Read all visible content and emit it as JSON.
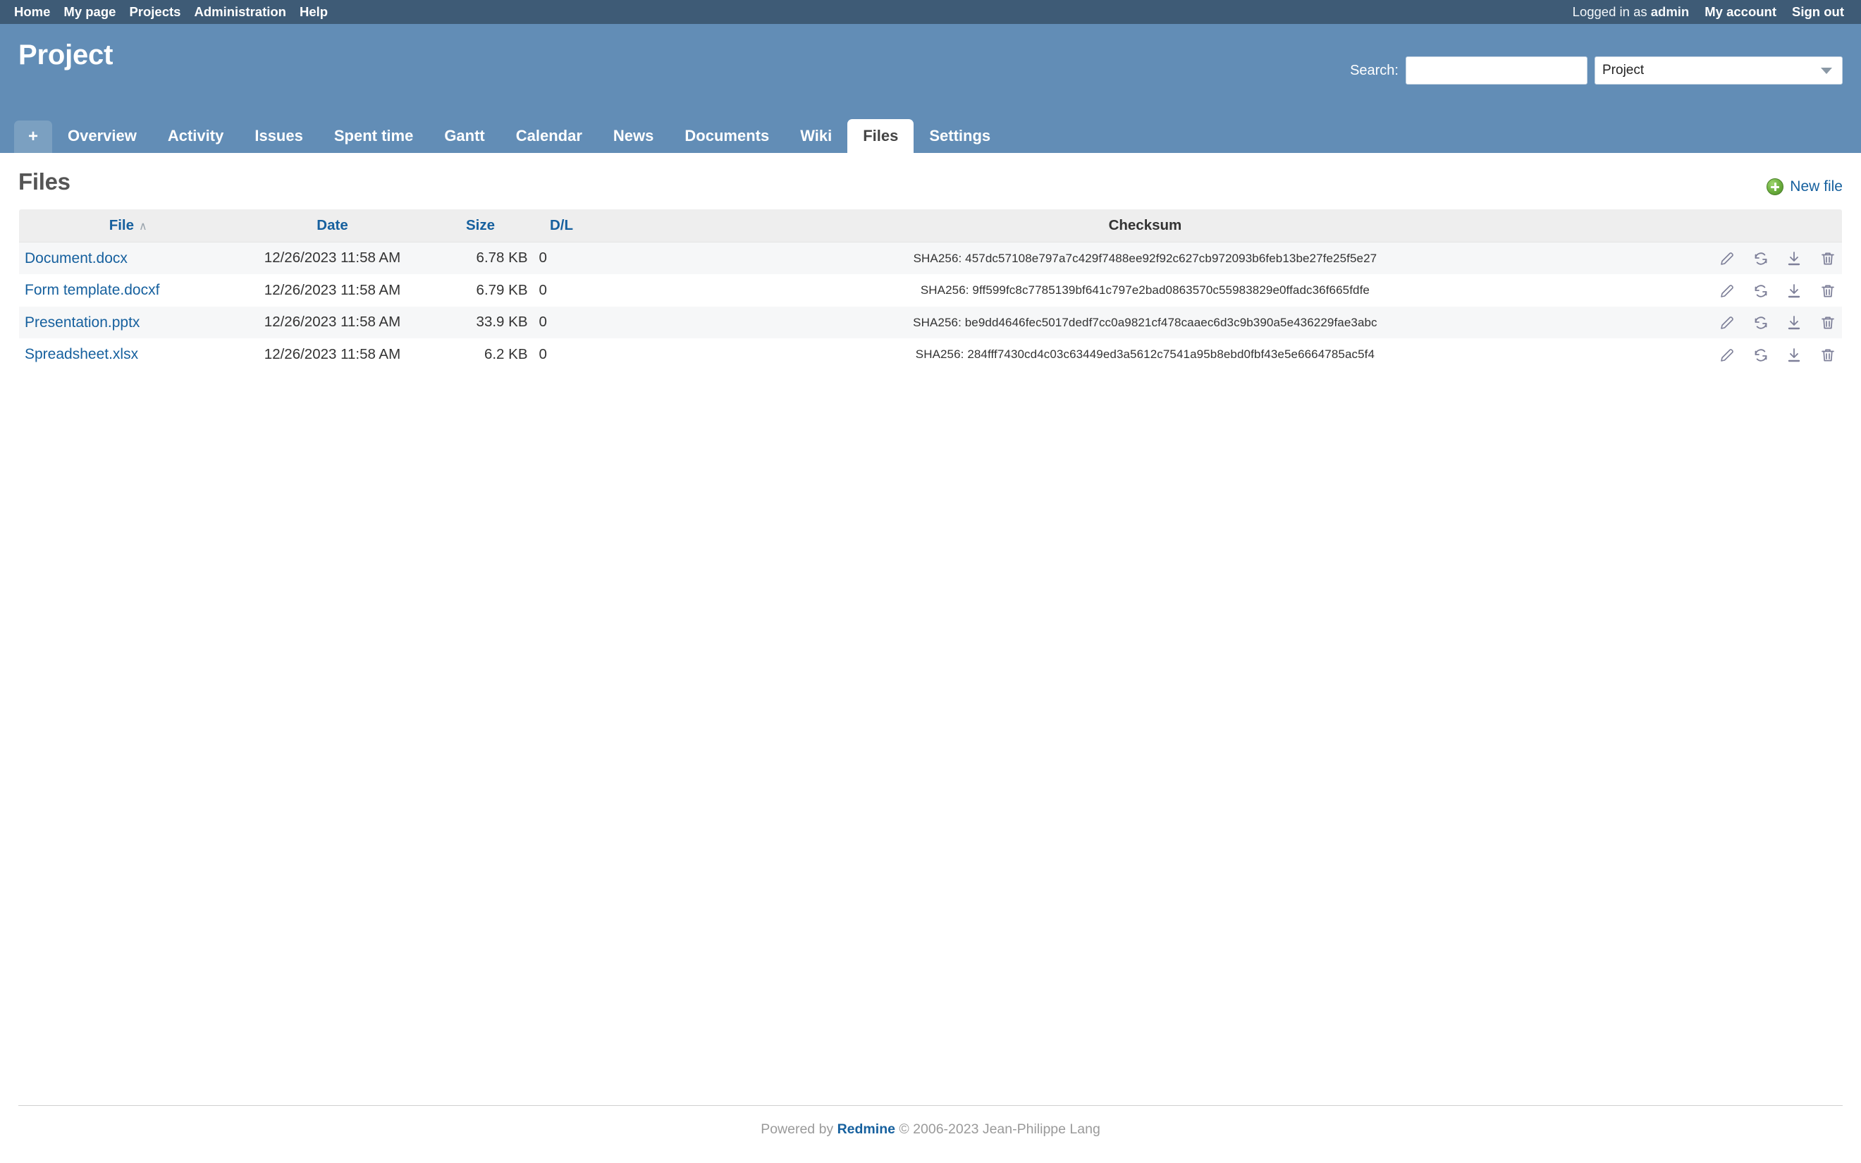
{
  "top_menu": {
    "left_items": [
      {
        "label": "Home",
        "name": "top-menu-home"
      },
      {
        "label": "My page",
        "name": "top-menu-my-page"
      },
      {
        "label": "Projects",
        "name": "top-menu-projects"
      },
      {
        "label": "Administration",
        "name": "top-menu-administration"
      },
      {
        "label": "Help",
        "name": "top-menu-help"
      }
    ],
    "logged_in_prefix": "Logged in as",
    "username": "admin",
    "my_account_label": "My account",
    "sign_out_label": "Sign out"
  },
  "header": {
    "project_title": "Project",
    "search_label": "Search:",
    "search_value": "",
    "search_placeholder": "",
    "search_scope_selected": "Project"
  },
  "main_menu": {
    "new_object_label": "+",
    "tabs": [
      {
        "label": "Overview",
        "name": "tab-overview",
        "selected": false
      },
      {
        "label": "Activity",
        "name": "tab-activity",
        "selected": false
      },
      {
        "label": "Issues",
        "name": "tab-issues",
        "selected": false
      },
      {
        "label": "Spent time",
        "name": "tab-spent-time",
        "selected": false
      },
      {
        "label": "Gantt",
        "name": "tab-gantt",
        "selected": false
      },
      {
        "label": "Calendar",
        "name": "tab-calendar",
        "selected": false
      },
      {
        "label": "News",
        "name": "tab-news",
        "selected": false
      },
      {
        "label": "Documents",
        "name": "tab-documents",
        "selected": false
      },
      {
        "label": "Wiki",
        "name": "tab-wiki",
        "selected": false
      },
      {
        "label": "Files",
        "name": "tab-files",
        "selected": true
      },
      {
        "label": "Settings",
        "name": "tab-settings",
        "selected": false
      }
    ]
  },
  "content": {
    "page_title": "Files",
    "new_file_label": "New file",
    "sort_indicator": "∧",
    "columns": {
      "file": "File",
      "date": "Date",
      "size": "Size",
      "dl": "D/L",
      "checksum": "Checksum"
    },
    "rows": [
      {
        "filename": "Document.docx",
        "date": "12/26/2023 11:58 AM",
        "size": "6.78 KB",
        "downloads": "0",
        "checksum": "SHA256: 457dc57108e797a7c429f7488ee92f92c627cb972093b6feb13be27fe25f5e27"
      },
      {
        "filename": "Form template.docxf",
        "date": "12/26/2023 11:58 AM",
        "size": "6.79 KB",
        "downloads": "0",
        "checksum": "SHA256: 9ff599fc8c7785139bf641c797e2bad0863570c55983829e0ffadc36f665fdfe"
      },
      {
        "filename": "Presentation.pptx",
        "date": "12/26/2023 11:58 AM",
        "size": "33.9 KB",
        "downloads": "0",
        "checksum": "SHA256: be9dd4646fec5017dedf7cc0a9821cf478caaec6d3c9b390a5e436229fae3abc"
      },
      {
        "filename": "Spreadsheet.xlsx",
        "date": "12/26/2023 11:58 AM",
        "size": "6.2 KB",
        "downloads": "0",
        "checksum": "SHA256: 284fff7430cd4c03c63449ed3a5612c7541a95b8ebd0fbf43e5e6664785ac5f4"
      }
    ],
    "row_actions": [
      {
        "name": "edit-icon",
        "title": "Edit"
      },
      {
        "name": "update-icon",
        "title": "Update"
      },
      {
        "name": "download-icon",
        "title": "Download"
      },
      {
        "name": "delete-icon",
        "title": "Delete"
      }
    ]
  },
  "footer": {
    "powered_by": "Powered by",
    "redmine_label": "Redmine",
    "copyright": "© 2006-2023 Jean-Philippe Lang"
  },
  "colors": {
    "top_bar": "#3e5b76",
    "header_bar": "#628db6",
    "link": "#16609e",
    "accent_green": "#6aad3c",
    "row_odd": "#f6f7f8",
    "table_head": "#eeeeee"
  }
}
